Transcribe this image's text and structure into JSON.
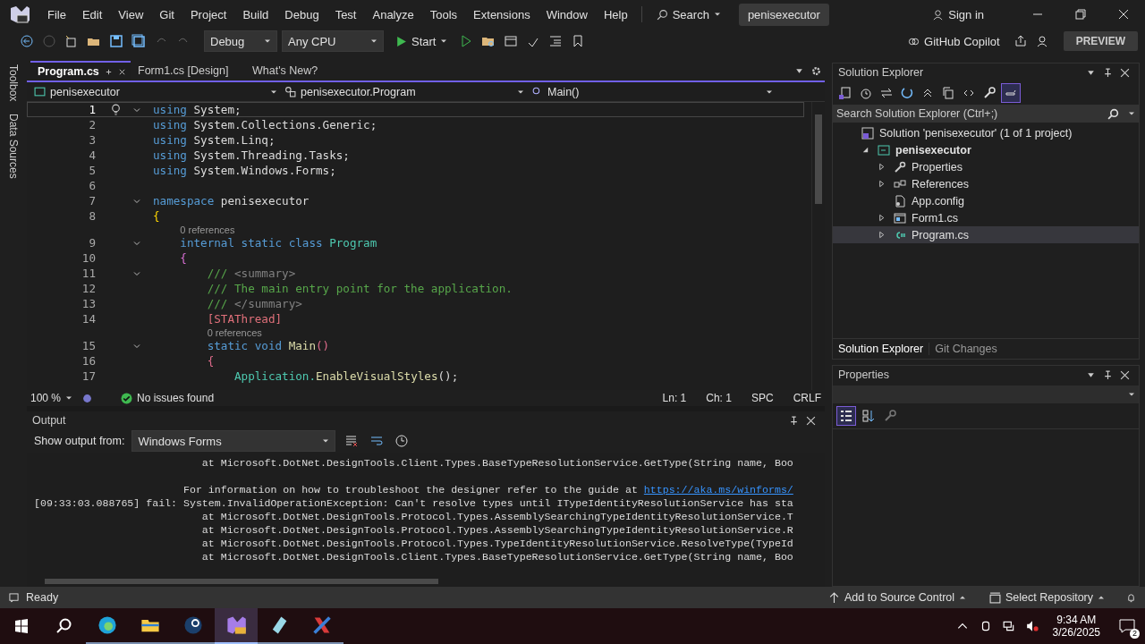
{
  "menu": [
    "File",
    "Edit",
    "View",
    "Git",
    "Project",
    "Build",
    "Debug",
    "Test",
    "Analyze",
    "Tools",
    "Extensions",
    "Window",
    "Help"
  ],
  "search": {
    "label": "Search"
  },
  "solution_title": "penisexecutor",
  "sign_in": "Sign in",
  "toolbar": {
    "configuration": "Debug",
    "platform": "Any CPU",
    "start": "Start",
    "copilot": "GitHub Copilot",
    "preview": "PREVIEW"
  },
  "side_tabs": [
    "Toolbox",
    "Data Sources"
  ],
  "editor": {
    "tabs": [
      {
        "label": "Program.cs",
        "selected": true
      },
      {
        "label": "Form1.cs [Design]",
        "selected": false
      },
      {
        "label": "What's New?",
        "selected": false
      }
    ],
    "nav": {
      "project": "penisexecutor",
      "type": "penisexecutor.Program",
      "member": "Main()"
    },
    "lines": [
      {
        "number": "1",
        "foldable": true,
        "current": true,
        "tokens": [
          {
            "kind": "keyword",
            "text": "using"
          },
          {
            "kind": "plain",
            "text": " System;"
          }
        ]
      },
      {
        "number": "2",
        "foldable": false,
        "current": false,
        "tokens": [
          {
            "kind": "keyword",
            "text": "using"
          },
          {
            "kind": "plain",
            "text": " System.Collections.Generic;"
          }
        ]
      },
      {
        "number": "3",
        "foldable": false,
        "current": false,
        "tokens": [
          {
            "kind": "keyword",
            "text": "using"
          },
          {
            "kind": "plain",
            "text": " System.Linq;"
          }
        ]
      },
      {
        "number": "4",
        "foldable": false,
        "current": false,
        "tokens": [
          {
            "kind": "keyword",
            "text": "using"
          },
          {
            "kind": "plain",
            "text": " System.Threading.Tasks;"
          }
        ]
      },
      {
        "number": "5",
        "foldable": false,
        "current": false,
        "tokens": [
          {
            "kind": "keyword",
            "text": "using"
          },
          {
            "kind": "plain",
            "text": " System.Windows.Forms;"
          }
        ]
      },
      {
        "number": "6",
        "foldable": false,
        "current": false
      },
      {
        "number": "7",
        "foldable": true,
        "current": false,
        "tokens": [
          {
            "kind": "keyword",
            "text": "namespace"
          },
          {
            "kind": "plain",
            "text": " penisexecutor"
          }
        ]
      },
      {
        "number": "8",
        "foldable": false,
        "current": false,
        "tokens": [
          {
            "kind": "brace1",
            "text": "{"
          }
        ]
      },
      {
        "number": "9",
        "foldable": true,
        "current": false,
        "codelens": "0 references",
        "tokens": [
          {
            "kind": "keyword",
            "text": "    internal static class"
          },
          {
            "kind": "type",
            "text": " Program"
          }
        ]
      },
      {
        "number": "10",
        "foldable": false,
        "current": false,
        "tokens": [
          {
            "kind": "brace2",
            "text": "    {"
          }
        ]
      },
      {
        "number": "11",
        "foldable": true,
        "current": false,
        "tokens": [
          {
            "kind": "comment",
            "text": "        /// "
          },
          {
            "kind": "doctag",
            "text": "<summary>"
          }
        ]
      },
      {
        "number": "12",
        "foldable": false,
        "current": false,
        "tokens": [
          {
            "kind": "comment",
            "text": "        /// The main entry point for the application."
          }
        ]
      },
      {
        "number": "13",
        "foldable": false,
        "current": false,
        "tokens": [
          {
            "kind": "comment",
            "text": "        /// "
          },
          {
            "kind": "doctag",
            "text": "</summary>"
          }
        ]
      },
      {
        "number": "14",
        "foldable": false,
        "current": false,
        "tokens": [
          {
            "kind": "attribute",
            "text": "        [STAThread]"
          }
        ]
      },
      {
        "number": "15",
        "foldable": true,
        "current": false,
        "codelens": "0 references",
        "tokens": [
          {
            "kind": "keyword",
            "text": "        static void"
          },
          {
            "kind": "method",
            "text": " Main"
          },
          {
            "kind": "brace3",
            "text": "()"
          }
        ]
      },
      {
        "number": "16",
        "foldable": false,
        "current": false,
        "tokens": [
          {
            "kind": "brace3",
            "text": "        {"
          }
        ]
      },
      {
        "number": "17",
        "foldable": false,
        "current": false,
        "tokens": [
          {
            "kind": "type",
            "text": "            Application."
          },
          {
            "kind": "method",
            "text": "EnableVisualStyles"
          },
          {
            "kind": "plain",
            "text": "();"
          }
        ]
      }
    ],
    "status": {
      "zoom": "100 %",
      "issues": "No issues found",
      "line": "Ln: 1",
      "column": "Ch: 1",
      "whitespace": "SPC",
      "line_ending": "CRLF"
    }
  },
  "output": {
    "title": "Output",
    "source_label": "Show output from:",
    "source": "Windows Forms",
    "lines": [
      {
        "blank_before": false,
        "text": "                           at Microsoft.DotNet.DesignTools.Client.Types.BaseTypeResolutionService.GetType(String name, Boo"
      },
      {
        "blank_before": true,
        "text": "                        For information on how to troubleshoot the designer refer to the guide at ",
        "link": "https://aka.ms/winforms/"
      },
      {
        "blank_before": false,
        "text": "[09:33:03.088765] fail: System.InvalidOperationException: Can't resolve types until ITypeIdentityResolutionService has sta"
      },
      {
        "blank_before": false,
        "text": "                           at Microsoft.DotNet.DesignTools.Protocol.Types.AssemblySearchingTypeIdentityResolutionService.T"
      },
      {
        "blank_before": false,
        "text": "                           at Microsoft.DotNet.DesignTools.Protocol.Types.AssemblySearchingTypeIdentityResolutionService.R"
      },
      {
        "blank_before": false,
        "text": "                           at Microsoft.DotNet.DesignTools.Protocol.Types.TypeIdentityResolutionService.ResolveType(TypeId"
      },
      {
        "blank_before": false,
        "text": "                           at Microsoft.DotNet.DesignTools.Client.Types.BaseTypeResolutionService.GetType(String name, Boo"
      }
    ]
  },
  "solution_explorer": {
    "title": "Solution Explorer",
    "search_placeholder": "Search Solution Explorer (Ctrl+;)",
    "tree": [
      {
        "label": "Solution 'penisexecutor' (1 of 1 project)",
        "kind": "solution",
        "selected": false,
        "children": [
          {
            "label": "penisexecutor",
            "kind": "project",
            "selected": false,
            "expanded": true,
            "children": [
              {
                "label": "Properties",
                "kind": "properties",
                "selected": false,
                "expanded": false
              },
              {
                "label": "References",
                "kind": "references",
                "selected": false,
                "expanded": false
              },
              {
                "label": "App.config",
                "kind": "config",
                "selected": false
              },
              {
                "label": "Form1.cs",
                "kind": "form",
                "selected": false,
                "expanded": false
              },
              {
                "label": "Program.cs",
                "kind": "csharp",
                "selected": true,
                "expanded": false
              }
            ]
          }
        ]
      }
    ],
    "bottom_tabs": [
      {
        "label": "Solution Explorer",
        "selected": true
      },
      {
        "label": "Git Changes",
        "selected": false
      }
    ]
  },
  "properties": {
    "title": "Properties"
  },
  "status_bar": {
    "state": "Ready",
    "source_control": "Add to Source Control",
    "repository": "Select Repository"
  },
  "taskbar": {
    "apps": [
      {
        "kind": "edge",
        "selected": false
      },
      {
        "kind": "folder",
        "selected": false
      },
      {
        "kind": "steam",
        "selected": false
      },
      {
        "kind": "visualstudio",
        "selected": true
      },
      {
        "kind": "notepad",
        "selected": false
      },
      {
        "kind": "xtool",
        "selected": false
      }
    ],
    "time": "9:34 AM",
    "date": "3/26/2025",
    "notifications": "2"
  }
}
